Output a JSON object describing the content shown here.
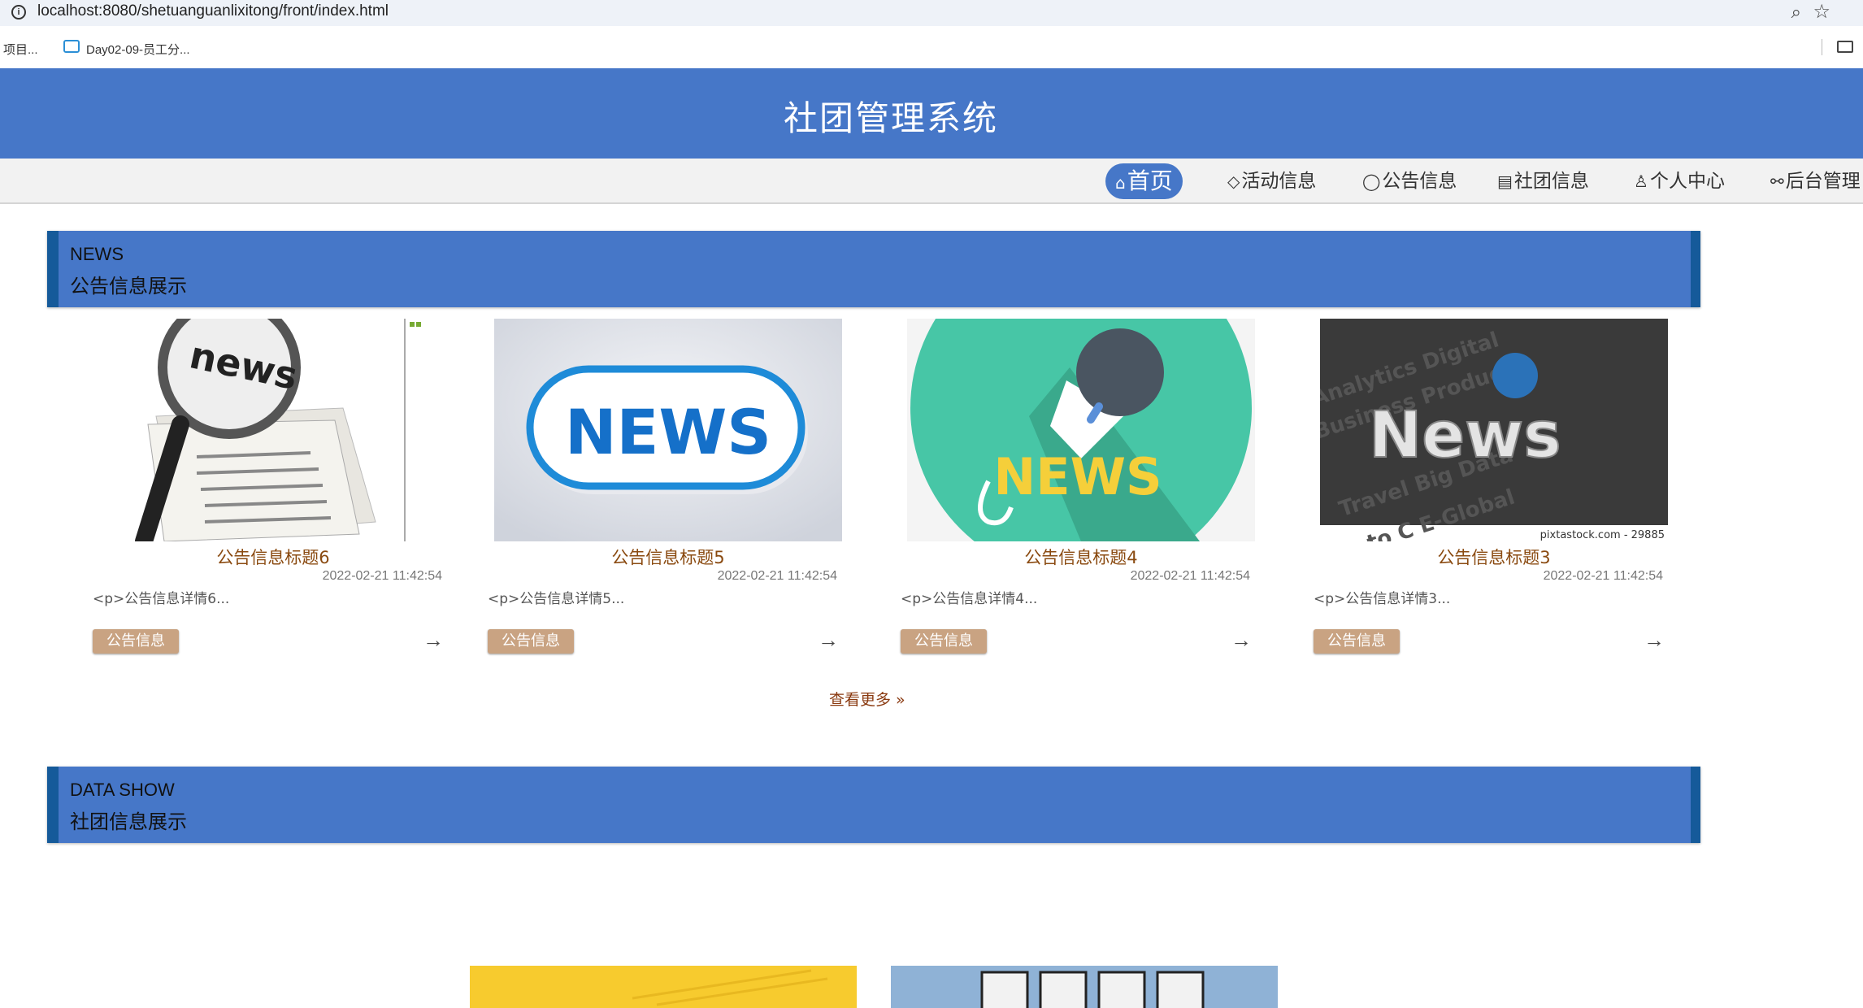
{
  "browser": {
    "url": "localhost:8080/shetuanguanlixitong/front/index.html",
    "bookmarks": [
      "项目...",
      "Day02-09-员工分..."
    ]
  },
  "site": {
    "title": "社团管理系统"
  },
  "nav": {
    "items": [
      {
        "label": "首页",
        "icon": "home-icon",
        "glyph": "⌂"
      },
      {
        "label": "活动信息",
        "icon": "tag-icon",
        "glyph": "◇"
      },
      {
        "label": "公告信息",
        "icon": "bubble-icon",
        "glyph": "◯"
      },
      {
        "label": "社团信息",
        "icon": "doc-icon",
        "glyph": "▤"
      },
      {
        "label": "个人中心",
        "icon": "user-icon",
        "glyph": "♙"
      },
      {
        "label": "后台管理",
        "icon": "link-icon",
        "glyph": "⚯"
      }
    ]
  },
  "news_section": {
    "en": "NEWS",
    "cn": "公告信息展示"
  },
  "news": [
    {
      "title": "公告信息标题6",
      "date": "2022-02-21 11:42:54",
      "summary": "<p>公告信息详情6...",
      "tag": "公告信息"
    },
    {
      "title": "公告信息标题5",
      "date": "2022-02-21 11:42:54",
      "summary": "<p>公告信息详情5...",
      "tag": "公告信息"
    },
    {
      "title": "公告信息标题4",
      "date": "2022-02-21 11:42:54",
      "summary": "<p>公告信息详情4...",
      "tag": "公告信息"
    },
    {
      "title": "公告信息标题3",
      "date": "2022-02-21 11:42:54",
      "summary": "<p>公告信息详情3...",
      "tag": "公告信息"
    }
  ],
  "thumb_text": {
    "n1": "news",
    "n2": "NEWS",
    "n3": "NEWS",
    "n4": "News",
    "n4_caption": "pixtastock.com - 29885"
  },
  "more": {
    "label": "查看更多 »"
  },
  "data_section": {
    "en": "DATA SHOW",
    "cn": "社团信息展示"
  },
  "colors": {
    "primary": "#4677c8",
    "accent": "#155a9a",
    "tag": "#c9a382",
    "title": "#8a4a10"
  }
}
